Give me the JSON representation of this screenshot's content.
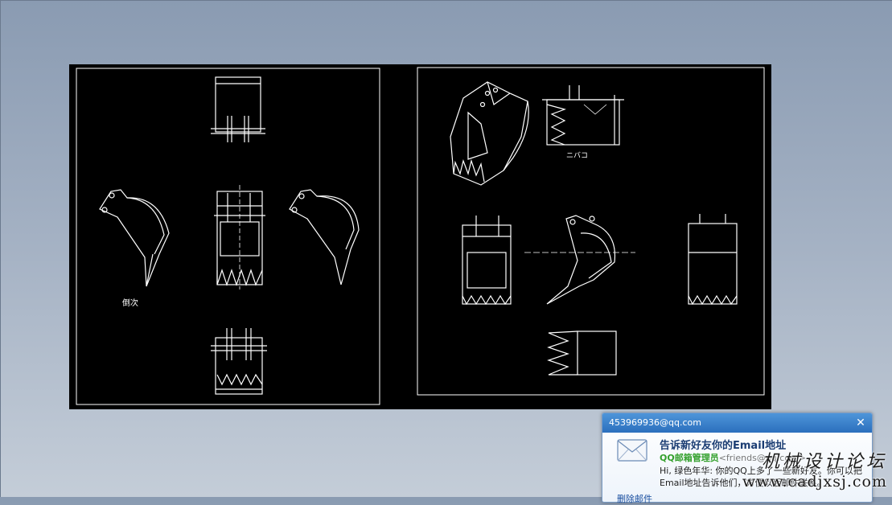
{
  "drawing": {
    "annotations": {
      "left_sheet_label": "倒次",
      "right_sheet_label": "ニバコ"
    }
  },
  "popup": {
    "account": "453969936@qq.com",
    "title": "告诉新好友你的Email地址",
    "sender_name": "QQ邮箱管理员",
    "sender_email": "<friends@qq.com>",
    "body": "Hi, 绿色年华: 你的QQ上多了一些新好友。你可以把Email地址告诉他们，方便以后邮件联系。",
    "delete_link": "删除邮件"
  },
  "watermark": {
    "cn": "机械设计论坛",
    "url": "www.cadjxsj.com"
  },
  "colors": {
    "canvas_bg": "#000000",
    "line": "#ffffff",
    "popup_header": "#2b6fbd"
  }
}
